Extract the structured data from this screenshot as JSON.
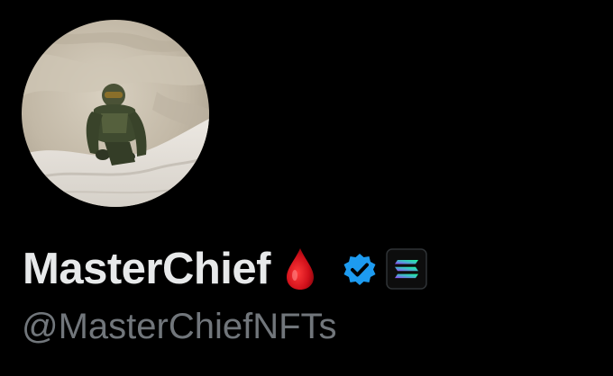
{
  "profile": {
    "display_name": "MasterChief",
    "handle": "@MasterChiefNFTs",
    "avatar_icon": "master-chief-figurine-photo",
    "name_emoji_icon": "drop-of-blood-icon",
    "verified_icon": "verified-badge-icon",
    "affiliate_icon": "solana-logo-icon"
  },
  "colors": {
    "background": "#000000",
    "name_text": "#e7e9ea",
    "handle_text": "#71767b",
    "verified_blue": "#1d9bf0",
    "blood_red": "#d0101a"
  }
}
